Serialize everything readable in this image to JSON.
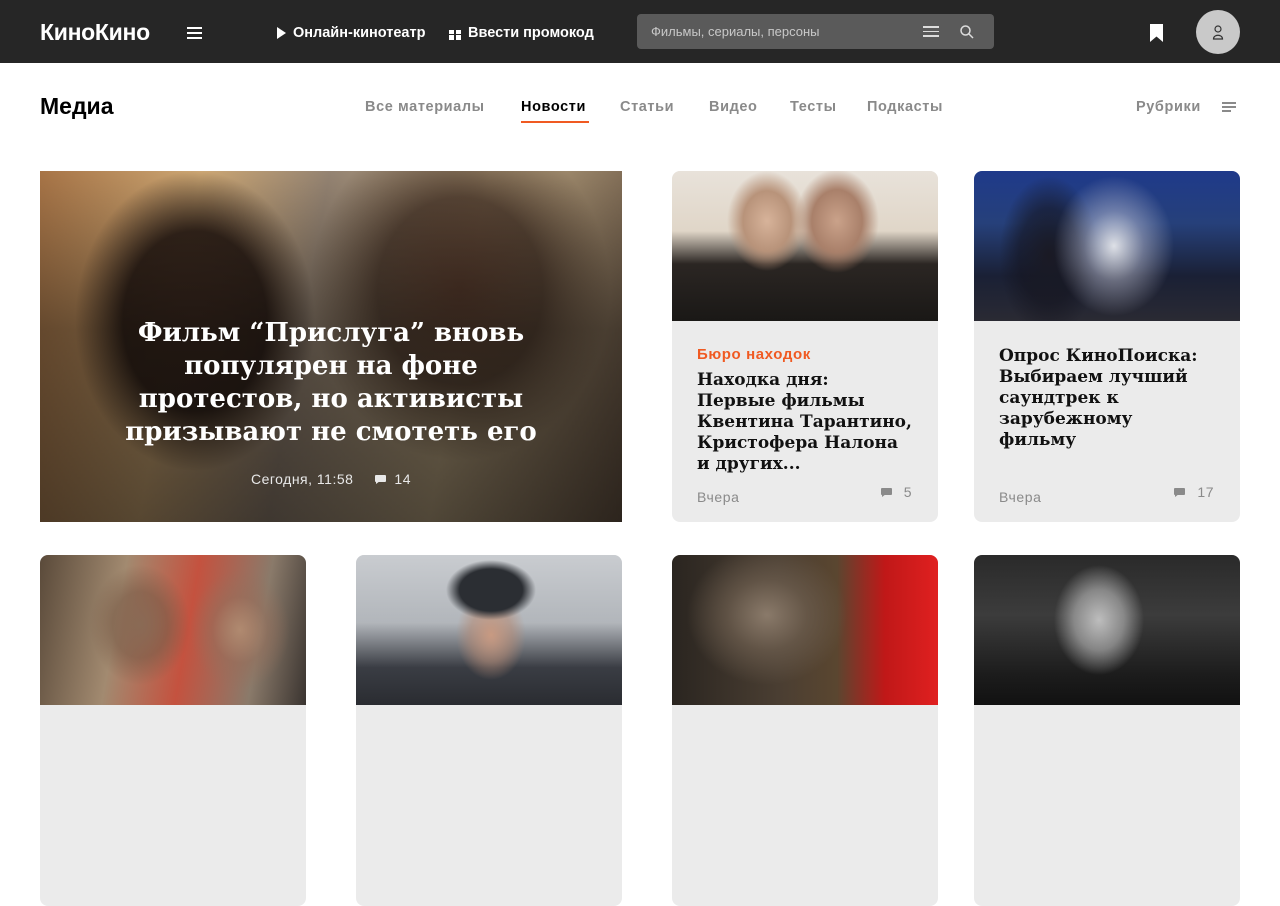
{
  "header": {
    "logo": "КиноКино",
    "nav_online": "Онлайн-кинотеатр",
    "nav_promo": "Ввести промокод",
    "search_placeholder": "Фильмы, сериалы, персоны"
  },
  "media": {
    "title": "Медиа",
    "tabs": [
      {
        "label": "Все материалы"
      },
      {
        "label": "Новости",
        "active": true
      },
      {
        "label": "Статьи"
      },
      {
        "label": "Видео"
      },
      {
        "label": "Тесты"
      },
      {
        "label": "Подкасты"
      }
    ],
    "rubrics_label": "Рубрики"
  },
  "hero": {
    "title": "Фильм “Прислуга” вновь популярен на фоне протестов, но активисты призывают не смотеть его",
    "date": "Сегодня, 11:58",
    "comments": "14"
  },
  "cards": [
    {
      "rubric": "Бюро находок",
      "title": "Находка дня: Первые фильмы Квентина Тарантино, Кристофера Налона и других...",
      "date": "Вчера",
      "comments": "5"
    },
    {
      "rubric": "",
      "title": "Опрос КиноПоиска: Выбираем лучший саундтрек к зарубежному фильму",
      "date": "Вчера",
      "comments": "17"
    }
  ],
  "colors": {
    "accent": "#f05a22",
    "topbar": "#262626",
    "card_bg": "#ebebeb"
  }
}
